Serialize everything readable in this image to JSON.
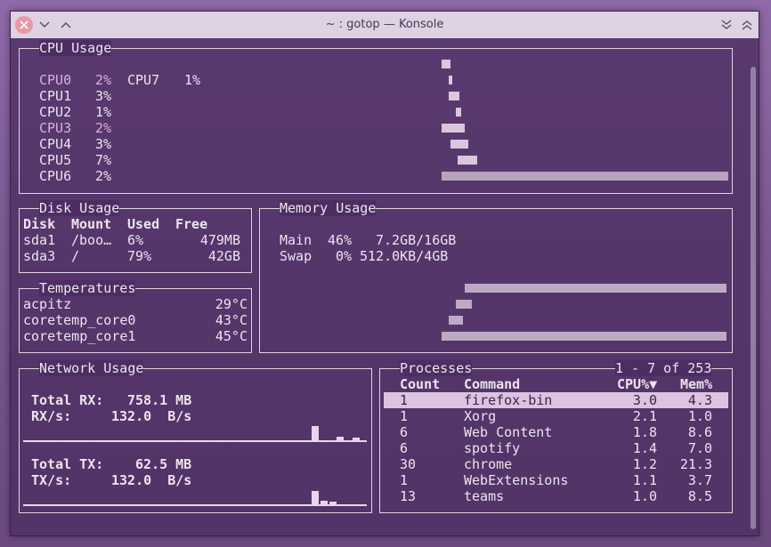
{
  "titlebar": {
    "title": "~ : gotop — Konsole"
  },
  "cpu": {
    "title": "CPU Usage",
    "cores": [
      {
        "label": "CPU0",
        "value": "2%"
      },
      {
        "label": "CPU1",
        "value": "3%"
      },
      {
        "label": "CPU2",
        "value": "1%"
      },
      {
        "label": "CPU3",
        "value": "2%"
      },
      {
        "label": "CPU4",
        "value": "3%"
      },
      {
        "label": "CPU5",
        "value": "7%"
      },
      {
        "label": "CPU6",
        "value": "2%"
      },
      {
        "label": "CPU7",
        "value": "1%"
      }
    ]
  },
  "disk": {
    "title": "Disk Usage",
    "headers": [
      "Disk",
      "Mount",
      "Used",
      "Free"
    ],
    "rows": [
      [
        "sda1",
        "/boo…",
        "6%",
        "479MB"
      ],
      [
        "sda3",
        "/",
        "79%",
        "42GB"
      ]
    ]
  },
  "memory": {
    "title": "Memory Usage",
    "main_label": "Main",
    "main_pct": "46%",
    "main_amount": "7.2GB/16GB",
    "swap_label": "Swap",
    "swap_pct": "0%",
    "swap_amount": "512.0KB/4GB"
  },
  "temps": {
    "title": "Temperatures",
    "rows": [
      {
        "name": "acpitz",
        "value": "29°C"
      },
      {
        "name": "coretemp_core0",
        "value": "43°C"
      },
      {
        "name": "coretemp_core1",
        "value": "45°C"
      }
    ]
  },
  "network": {
    "title": "Network Usage",
    "rx_total_label": "Total RX:",
    "rx_total": "758.1 MB",
    "rx_rate_label": "RX/s:",
    "rx_rate": "132.0  B/s",
    "tx_total_label": "Total TX:",
    "tx_total": "62.5 MB",
    "tx_rate_label": "TX/s:",
    "tx_rate": "132.0  B/s"
  },
  "processes": {
    "title": "Processes",
    "range": "1 - 7 of 253",
    "headers": [
      "Count",
      "Command",
      "CPU%▼",
      "Mem%"
    ],
    "rows": [
      [
        "1",
        "firefox-bin",
        "3.0",
        "4.3"
      ],
      [
        "1",
        "Xorg",
        "2.1",
        "1.0"
      ],
      [
        "6",
        "Web Content",
        "1.8",
        "8.6"
      ],
      [
        "6",
        "spotify",
        "1.4",
        "7.0"
      ],
      [
        "30",
        "chrome",
        "1.2",
        "21.3"
      ],
      [
        "1",
        "WebExtensions",
        "1.1",
        "3.7"
      ],
      [
        "13",
        "teams",
        "1.0",
        "8.5"
      ]
    ]
  },
  "colors": {
    "highlight": "#dbb0dd",
    "selected_row_bg": "#dcc4e0",
    "text": "#ece4f0"
  }
}
